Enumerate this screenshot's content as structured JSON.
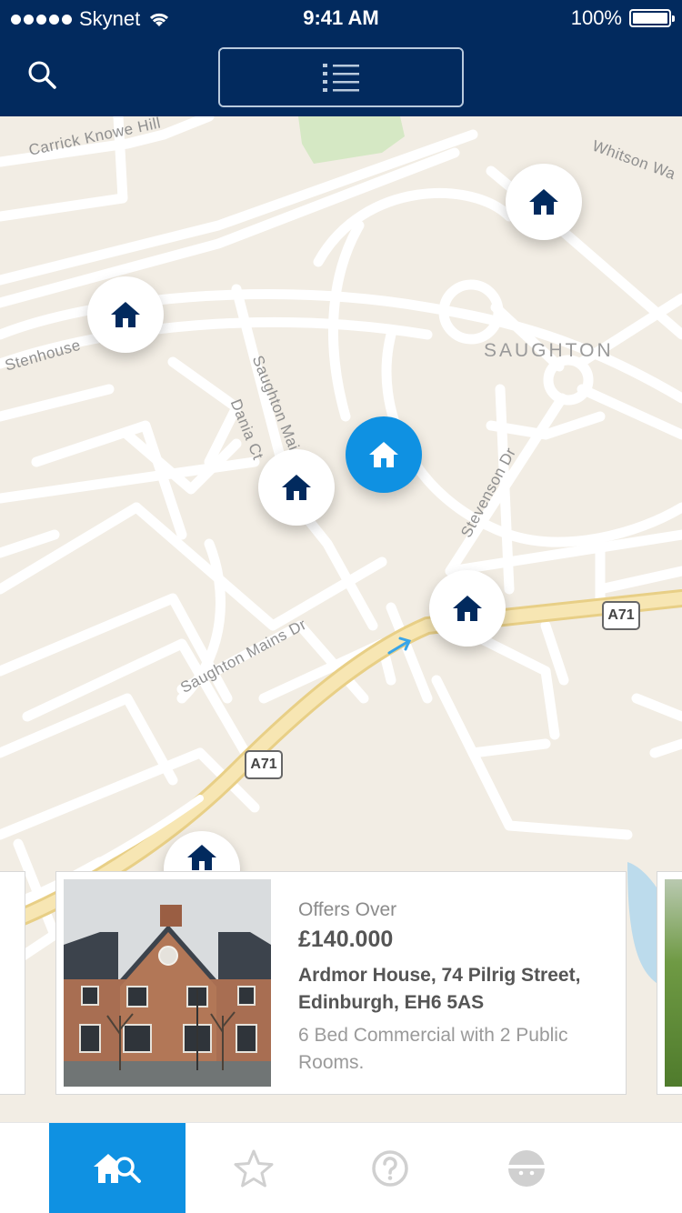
{
  "status_bar": {
    "carrier": "Skynet",
    "time": "9:41 AM",
    "battery": "100%"
  },
  "nav": {
    "views": [
      {
        "name": "list",
        "icon": "list-icon",
        "selected": false
      },
      {
        "name": "map",
        "icon": "map-pin-icon",
        "selected": true
      }
    ]
  },
  "map": {
    "labels": {
      "carrick": "Carrick Knowe Hill",
      "whitson": "Whitson Wa",
      "stenhouse": "Stenhouse",
      "saughton": "SAUGHTON",
      "saughton_mains_st": "Saughton Mains St",
      "dania": "Dania Ct",
      "stevenson": "Stevenson Dr",
      "saughton_mains_dr": "Saughton Mains Dr"
    },
    "road_shields": [
      "A71",
      "A71"
    ],
    "pins": [
      {
        "icon": "house-icon",
        "active": false
      },
      {
        "icon": "house-icon",
        "active": false
      },
      {
        "icon": "house-icon",
        "active": false
      },
      {
        "icon": "house-icon",
        "active": true
      },
      {
        "icon": "house-icon",
        "active": false
      },
      {
        "icon": "house-icon",
        "active": false
      }
    ]
  },
  "listing": {
    "offer_label": "Offers Over",
    "price": "£140.000",
    "address": "Ardmor House, 74 Pilrig Street, Edinburgh, EH6 5AS",
    "description": "6 Bed Commercial with 2 Public Rooms."
  },
  "tabbar": {
    "items": [
      {
        "icon": "home-search-icon",
        "selected": true
      },
      {
        "icon": "star-icon",
        "selected": false
      },
      {
        "icon": "help-icon",
        "selected": false
      },
      {
        "icon": "profile-icon",
        "selected": false
      }
    ]
  },
  "colors": {
    "navy": "#022a5e",
    "accent": "#0f91e2",
    "map_bg": "#f2ede4",
    "road": "#ffffff",
    "highway": "#f7e2a6"
  }
}
